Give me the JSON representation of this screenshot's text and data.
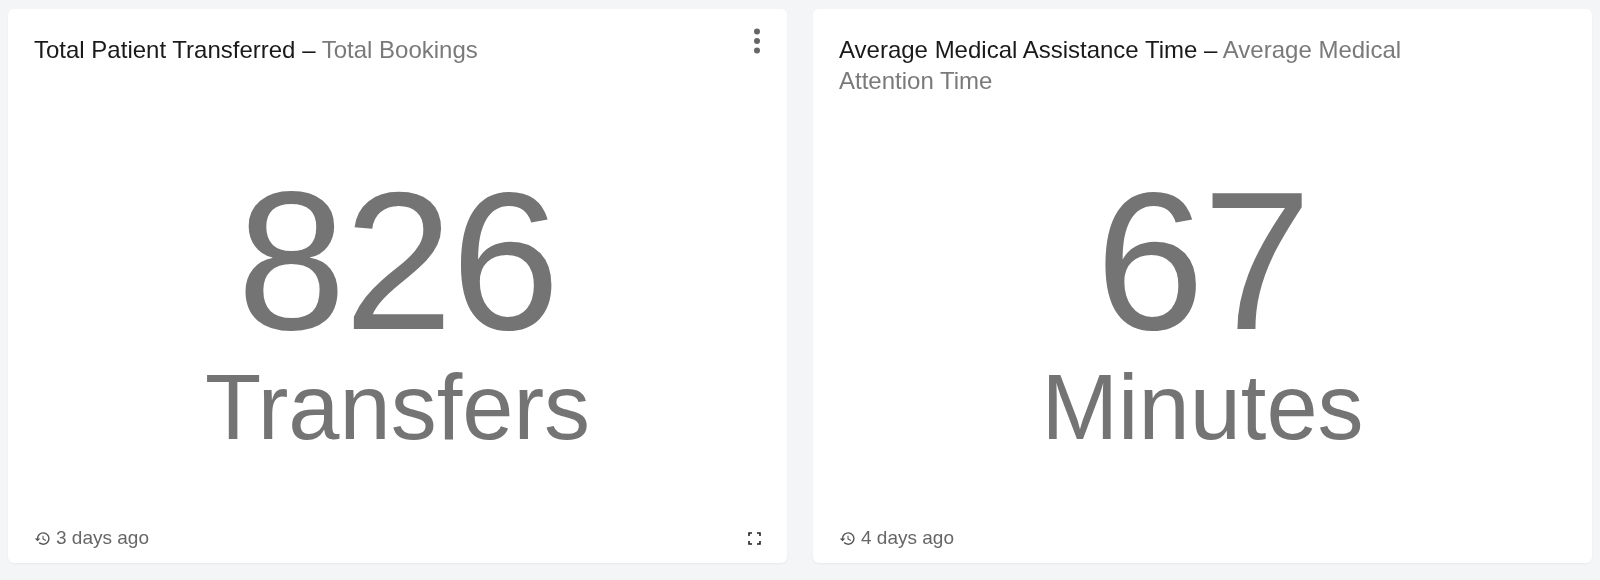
{
  "cards": [
    {
      "title": "Total Patient Transferred",
      "separator": "–",
      "subtitle": "Total Bookings",
      "value": "826",
      "unit": "Transfers",
      "updated": "3 days ago",
      "show_actions": true
    },
    {
      "title": "Average Medical Assistance Time",
      "separator": "–",
      "subtitle": "Average Medical Attention Time",
      "value": "67",
      "unit": "Minutes",
      "updated": "4 days ago",
      "show_actions": false
    }
  ]
}
